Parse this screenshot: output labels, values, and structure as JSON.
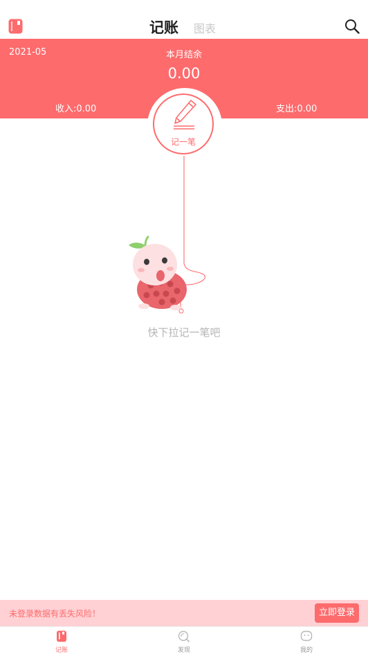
{
  "header": {
    "tabs": [
      {
        "label": "记账",
        "active": true
      },
      {
        "label": "图表",
        "active": false
      }
    ]
  },
  "summary": {
    "month": "2021-05",
    "balance_label": "本月结余",
    "balance_value": "0.00",
    "income": "收入:0.00",
    "expense": "支出:0.00"
  },
  "record_button": {
    "label": "记一笔"
  },
  "empty_state": {
    "hint": "快下拉记一笔吧"
  },
  "login_banner": {
    "message": "未登录数据有丢失风险！",
    "button_label": "立即登录"
  },
  "bottom_nav": [
    {
      "label": "记账",
      "icon": "ledger-icon",
      "active": true
    },
    {
      "label": "发现",
      "icon": "discover-icon",
      "active": false
    },
    {
      "label": "我的",
      "icon": "profile-icon",
      "active": false
    }
  ],
  "colors": {
    "accent": "#fd6b6d",
    "banner_bg": "#ffd1d4",
    "inactive": "#9a9a9a"
  }
}
